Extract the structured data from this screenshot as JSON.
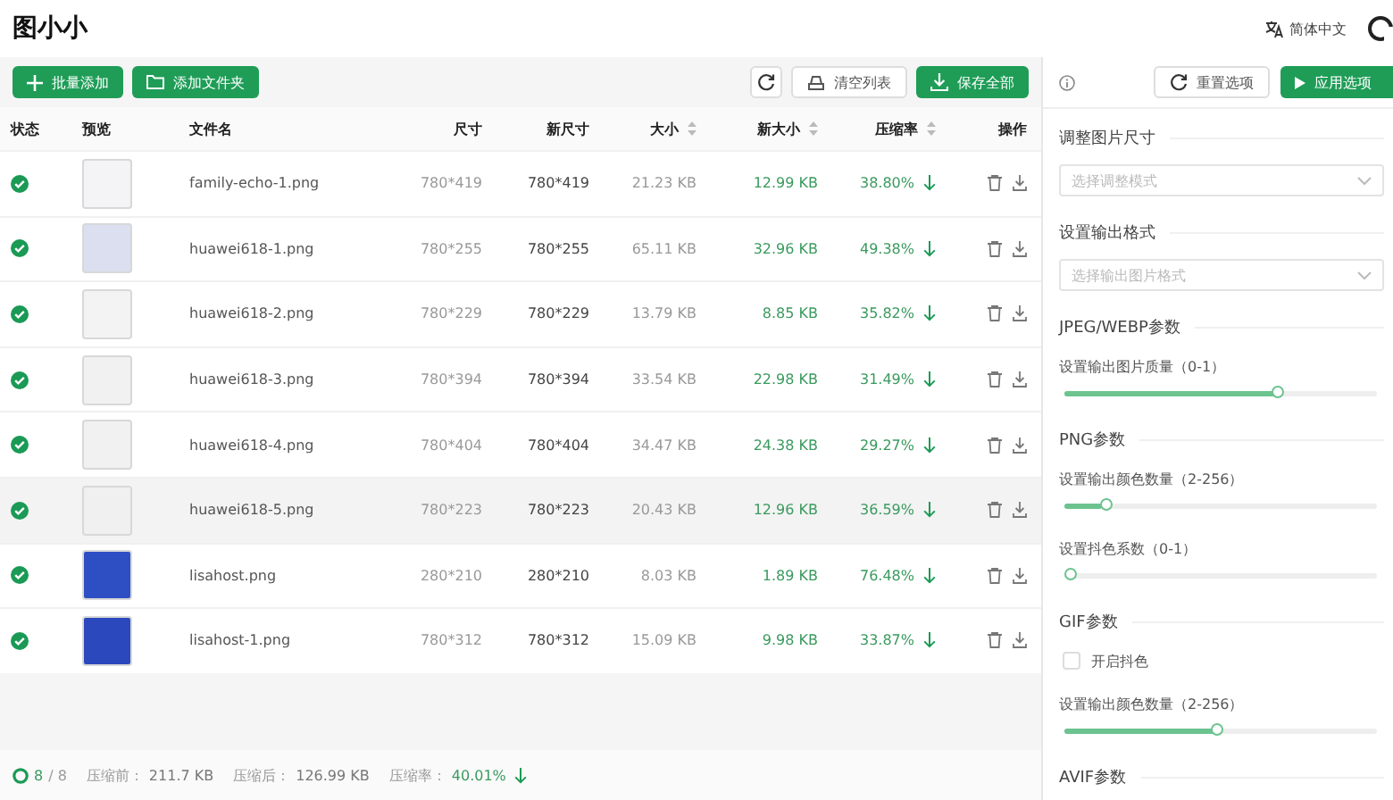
{
  "app": {
    "title": "图小小",
    "language": "简体中文"
  },
  "toolbar": {
    "add_batch": "批量添加",
    "add_folder": "添加文件夹",
    "clear": "清空列表",
    "save_all": "保存全部"
  },
  "table": {
    "columns": [
      {
        "label": "状态",
        "sortable": false
      },
      {
        "label": "预览",
        "sortable": false
      },
      {
        "label": "文件名",
        "sortable": false
      },
      {
        "label": "尺寸",
        "sortable": false
      },
      {
        "label": "新尺寸",
        "sortable": false
      },
      {
        "label": "大小",
        "sortable": true
      },
      {
        "label": "新大小",
        "sortable": true
      },
      {
        "label": "压缩率",
        "sortable": true
      },
      {
        "label": "操作",
        "sortable": false
      }
    ],
    "rows": [
      {
        "name": "family-echo-1.png",
        "size": "780*419",
        "new_size": "780*419",
        "bytes": "21.23 KB",
        "new_bytes": "12.99 KB",
        "rate": "38.80%",
        "color": "#f4f4f6",
        "hovered": false
      },
      {
        "name": "huawei618-1.png",
        "size": "780*255",
        "new_size": "780*255",
        "bytes": "65.11 KB",
        "new_bytes": "32.96 KB",
        "rate": "49.38%",
        "color": "#dcdff0",
        "hovered": false
      },
      {
        "name": "huawei618-2.png",
        "size": "780*229",
        "new_size": "780*229",
        "bytes": "13.79 KB",
        "new_bytes": "8.85 KB",
        "rate": "35.82%",
        "color": "#f3f3f3",
        "hovered": false
      },
      {
        "name": "huawei618-3.png",
        "size": "780*394",
        "new_size": "780*394",
        "bytes": "33.54 KB",
        "new_bytes": "22.98 KB",
        "rate": "31.49%",
        "color": "#f1f1f1",
        "hovered": false
      },
      {
        "name": "huawei618-4.png",
        "size": "780*404",
        "new_size": "780*404",
        "bytes": "34.47 KB",
        "new_bytes": "24.38 KB",
        "rate": "29.27%",
        "color": "#f1f1f1",
        "hovered": false
      },
      {
        "name": "huawei618-5.png",
        "size": "780*223",
        "new_size": "780*223",
        "bytes": "20.43 KB",
        "new_bytes": "12.96 KB",
        "rate": "36.59%",
        "color": "#f0f0f0",
        "hovered": true
      },
      {
        "name": "lisahost.png",
        "size": "280*210",
        "new_size": "280*210",
        "bytes": "8.03 KB",
        "new_bytes": "1.89 KB",
        "rate": "76.48%",
        "color": "#2e4fc4",
        "hovered": false
      },
      {
        "name": "lisahost-1.png",
        "size": "780*312",
        "new_size": "780*312",
        "bytes": "15.09 KB",
        "new_bytes": "9.98 KB",
        "rate": "33.87%",
        "color": "#2b48bd",
        "hovered": false
      }
    ]
  },
  "footer": {
    "done": "8",
    "total": "/ 8",
    "before_label": "压缩前：",
    "before": "211.7 KB",
    "after_label": "压缩后：",
    "after": "126.99 KB",
    "rate_label": "压缩率：",
    "rate": "40.01%"
  },
  "options": {
    "reset": "重置选项",
    "apply": "应用选项",
    "items": [
      {
        "kind": "heading",
        "label": "调整图片尺寸"
      },
      {
        "kind": "select",
        "placeholder": "选择调整模式"
      },
      {
        "kind": "heading",
        "label": "设置输出格式"
      },
      {
        "kind": "select",
        "placeholder": "选择输出图片格式"
      },
      {
        "kind": "heading",
        "label": "JPEG/WEBP参数"
      },
      {
        "kind": "slider",
        "label": "设置输出图片质量（0-1）",
        "level": 0.69
      },
      {
        "kind": "heading",
        "label": "PNG参数"
      },
      {
        "kind": "slider",
        "label": "设置输出颜色数量（2-256）",
        "level": 0.12
      },
      {
        "kind": "slider",
        "label": "设置抖色系数（0-1）",
        "level": 0
      },
      {
        "kind": "heading",
        "label": "GIF参数"
      },
      {
        "kind": "checkbox",
        "label": "开启抖色",
        "checked": false
      },
      {
        "kind": "slider",
        "label": "设置输出颜色数量（2-256）",
        "level": 0.49
      },
      {
        "kind": "heading",
        "label": "AVIF参数"
      }
    ]
  }
}
